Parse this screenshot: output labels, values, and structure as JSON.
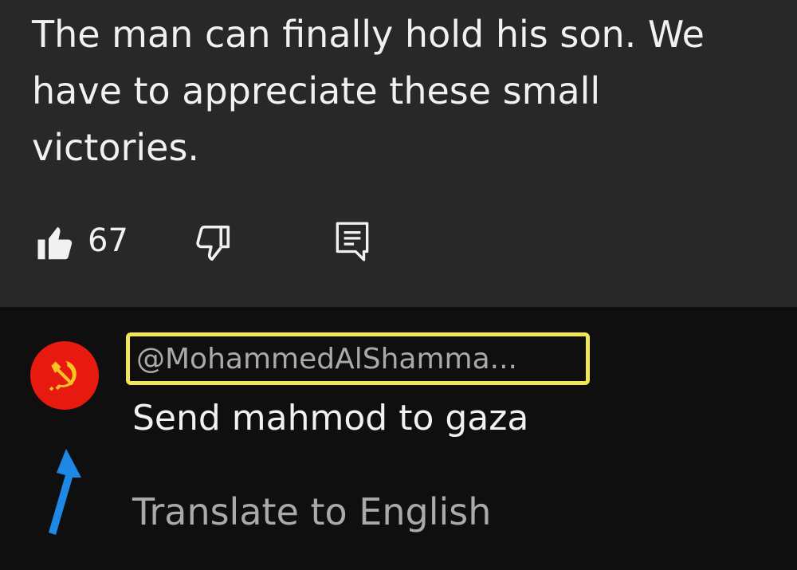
{
  "top_comment": {
    "text": "The man can finally hold his son. We have to appreciate these small victories.",
    "like_count": "67",
    "icons": {
      "like": "thumbs-up-icon",
      "dislike": "thumbs-down-icon",
      "reply": "reply-comment-icon"
    }
  },
  "reply": {
    "avatar_icon": "hammer-and-sickle-icon",
    "username": "@MohammedAlShamma...",
    "text": "Send mahmod to gaza",
    "translate_label": "Translate to English"
  },
  "annotations": {
    "highlight_color": "#f3e55a",
    "arrow_color": "#1e88e5"
  }
}
